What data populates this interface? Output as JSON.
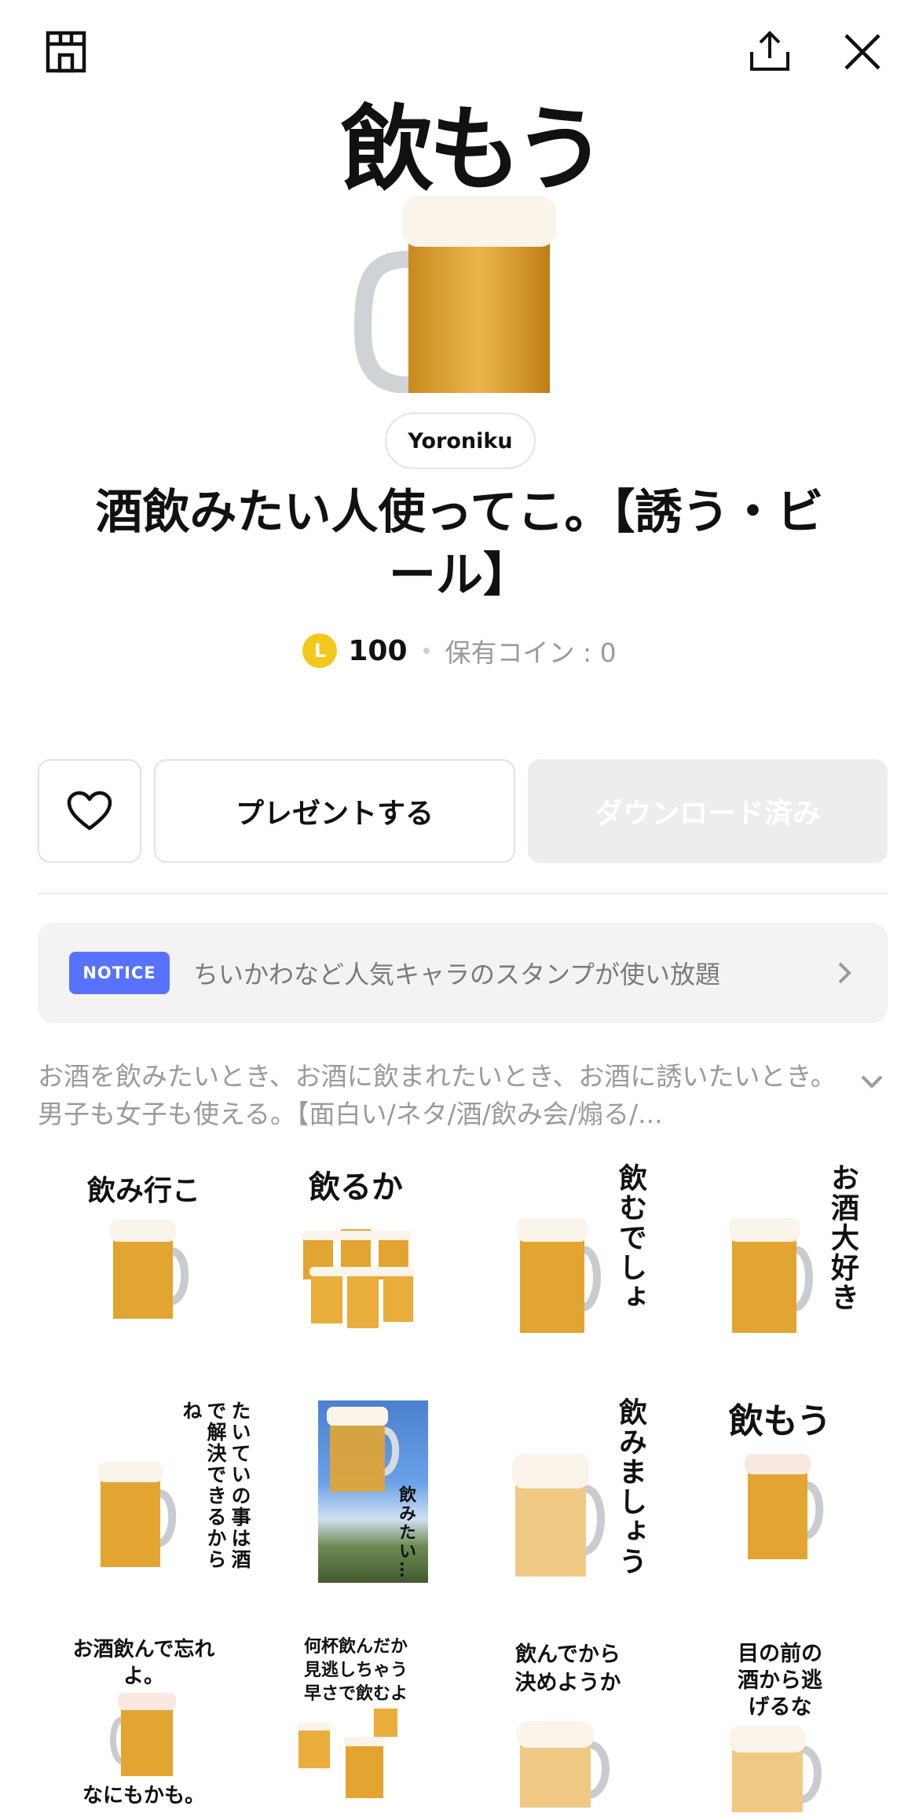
{
  "header": {
    "store_icon": "shop-icon",
    "share_icon": "share-icon",
    "close_icon": "close-icon"
  },
  "main_image": {
    "text": "飲もう"
  },
  "author": "Yoroniku",
  "title": "酒飲みたい人使ってこ。【誘う・ビール】",
  "price": {
    "coin_symbol": "L",
    "amount": "100",
    "owned": "保有コイン : 0"
  },
  "actions": {
    "like_icon": "heart-icon",
    "gift_label": "プレゼントする",
    "download_label": "ダウンロード済み"
  },
  "notice": {
    "badge": "NOTICE",
    "text": "ちいかわなど人気キャラのスタンプが使い放題"
  },
  "description": "お酒を飲みたいとき、お酒に飲まれたいとき、お酒に誘いたいとき。男子も女子も使える。【面白い/ネタ/酒/飲み会/煽る/...",
  "stickers": [
    {
      "caption": "飲み行こ"
    },
    {
      "caption": "飲るか"
    },
    {
      "caption": "飲むでしょ"
    },
    {
      "caption": "お酒大好き"
    },
    {
      "caption": "たいていの事は酒で解決できるからね"
    },
    {
      "caption": "飲みたい…"
    },
    {
      "caption": "飲みましょう"
    },
    {
      "caption": "飲もう"
    },
    {
      "caption": "お酒飲んで忘れよ。",
      "caption2": "なにもかも。"
    },
    {
      "caption": "何杯飲んだか見逃しちゃう早さで飲むよ"
    },
    {
      "caption": "飲んでから決めようか"
    },
    {
      "caption": "目の前の酒から逃げるな"
    }
  ],
  "colors": {
    "notice_badge": "#5872ff",
    "coin": "#f2c81c",
    "beer": "#e3a531",
    "foam": "#fbf4ea"
  }
}
